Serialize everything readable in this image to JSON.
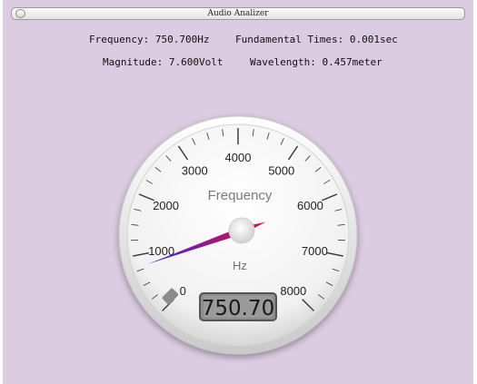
{
  "window": {
    "title": "Audio Analizer"
  },
  "readouts": {
    "frequency": "Frequency: 750.700Hz",
    "fundamental_times": "Fundamental Times: 0.001sec",
    "magnitude": "Magnitude: 7.600Volt",
    "wavelength": "Wavelength: 0.457meter"
  },
  "gauge": {
    "title": "Frequency",
    "unit": "Hz",
    "min": 0,
    "max": 8000,
    "value": 750.7,
    "display": "750.70",
    "tick_labels": [
      "0",
      "1000",
      "2000",
      "3000",
      "4000",
      "5000",
      "6000",
      "7000",
      "8000"
    ],
    "colors": {
      "background": "#dccce2",
      "needle_start": "#3b2bd0",
      "needle_end": "#e0103a",
      "display_bg": "#8d8d8d"
    }
  }
}
